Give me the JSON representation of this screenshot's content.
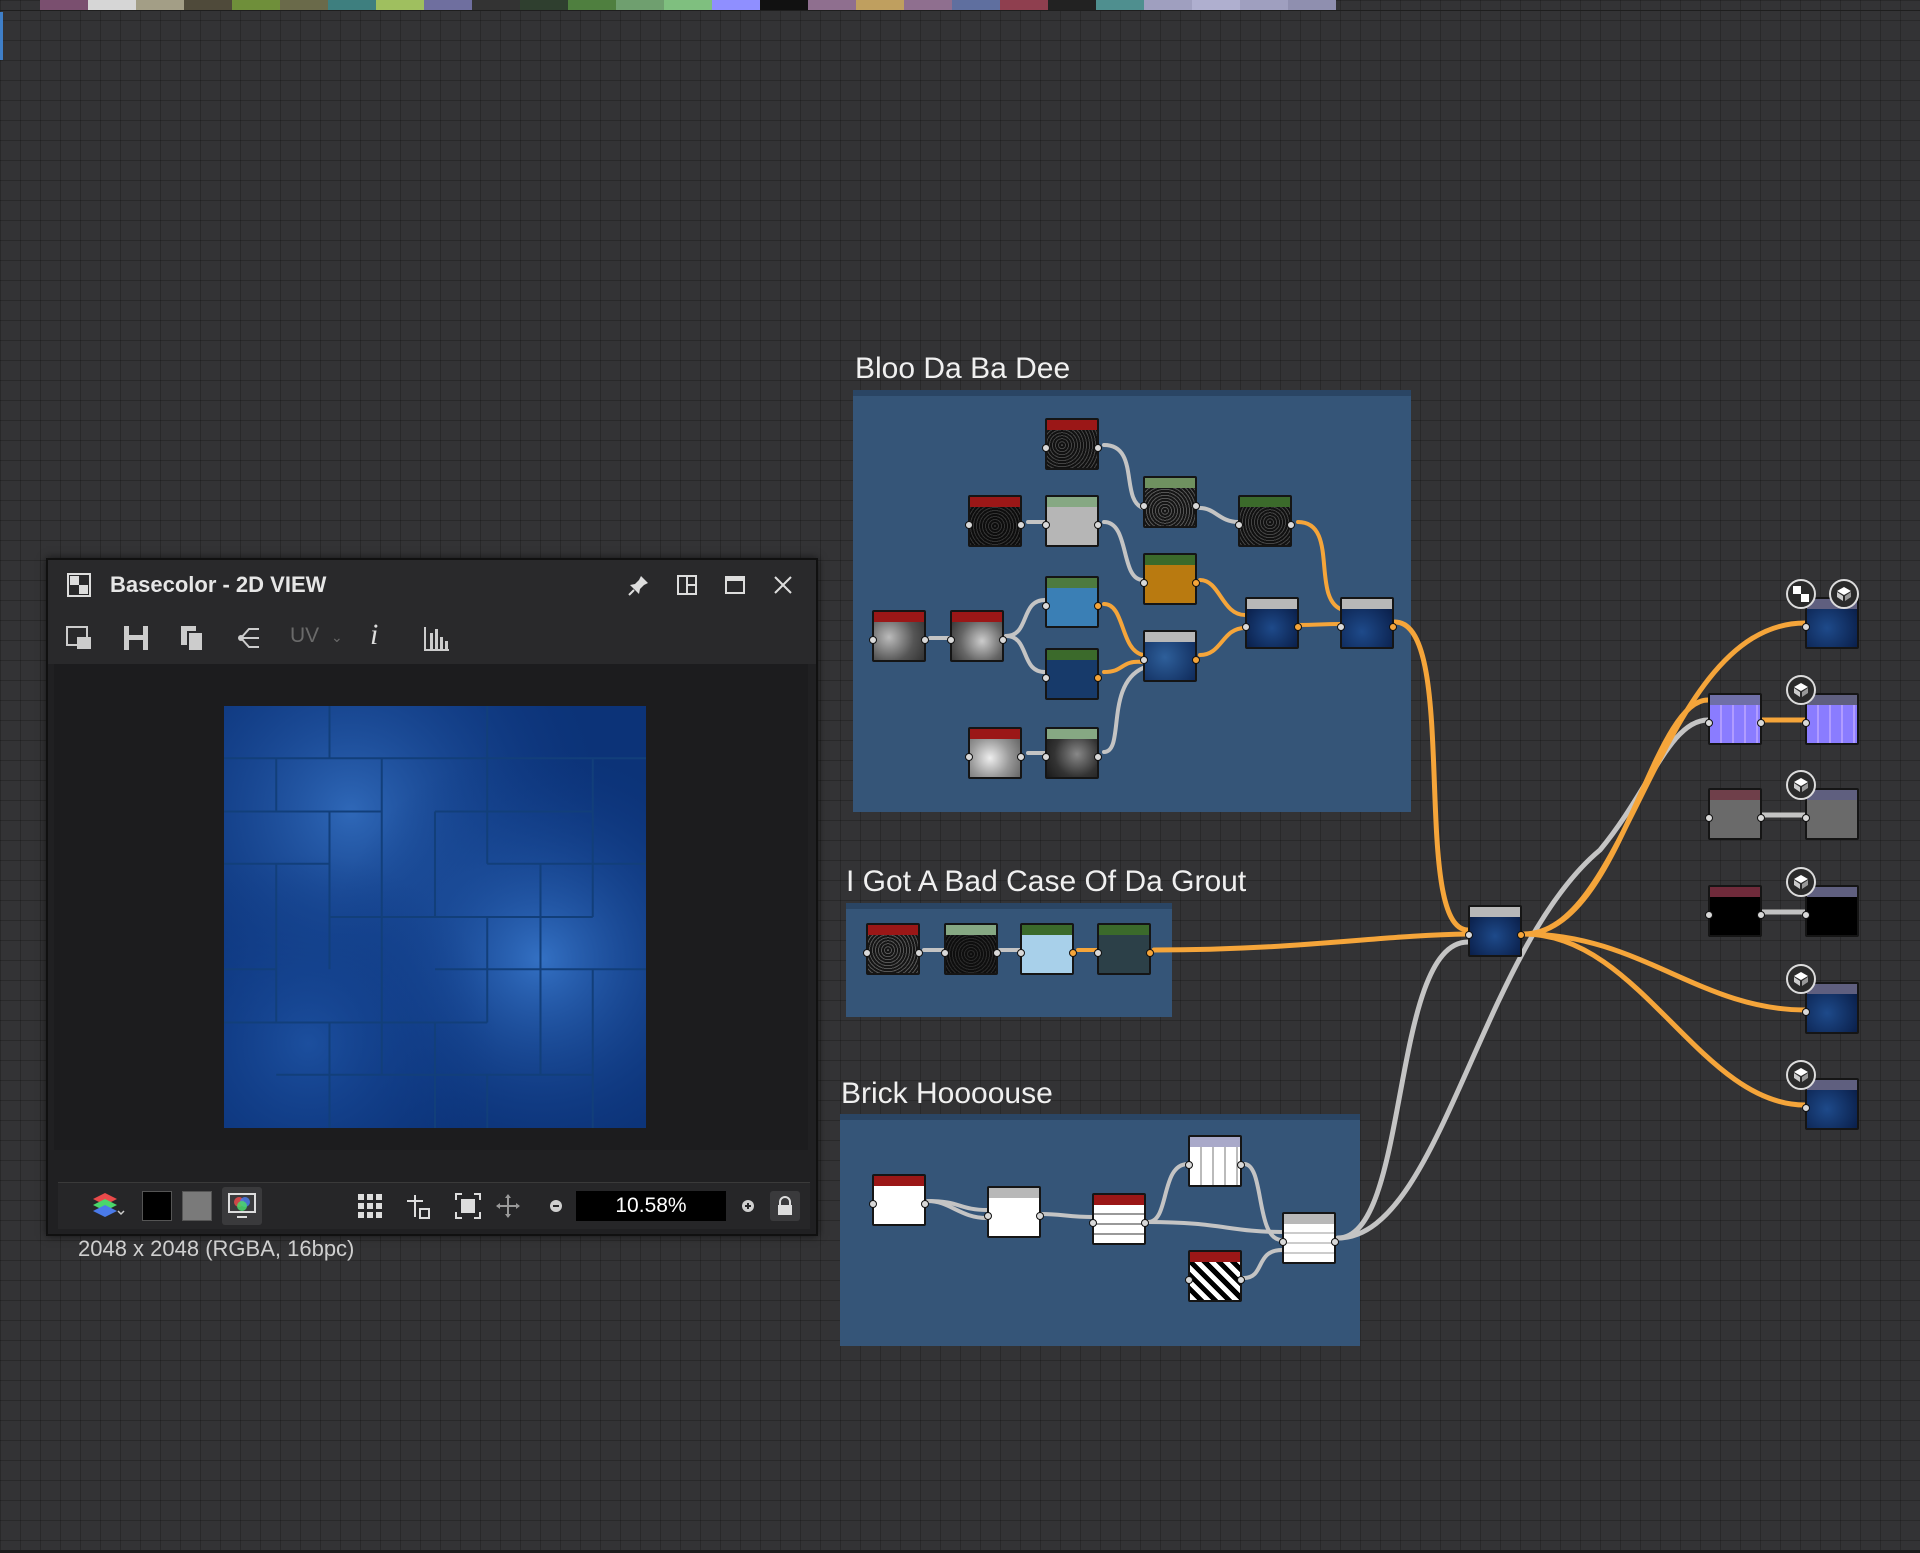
{
  "palette": [
    "#7a4f6f",
    "#d6d6d6",
    "#a39e86",
    "#4f4a3a",
    "#6f8f3a",
    "#6a6a4a",
    "#3e7f7f",
    "#9fbf5f",
    "#6f6f9f",
    "#333333",
    "#2f3f2f",
    "#4f7f3f",
    "#6f9f6f",
    "#7fbf7f",
    "#8f8fff",
    "#111111",
    "#8f6f8f",
    "#bf9f5f",
    "#8f6f8f",
    "#5f6f9f",
    "#8f3f4f",
    "#222222",
    "#4f8f8f",
    "#9f9fbf",
    "#afafcf",
    "#9f9fbf",
    "#8f8faf"
  ],
  "frames": [
    {
      "id": "bloo",
      "title": "Bloo Da Ba Dee"
    },
    {
      "id": "grout",
      "title": "I Got A Bad Case Of Da Grout"
    },
    {
      "id": "brick",
      "title": "Brick Hoooouse"
    }
  ],
  "colors": {
    "canvas": "#333335",
    "frame_fill": "#355578",
    "edge_orange": "#f5a53a",
    "edge_gray": "#c4c4c4",
    "header_red": "#9b1717",
    "header_green": "#4d7a3f",
    "header_grey": "#b8b8b8",
    "header_purple": "#6f6fa8"
  },
  "view2d": {
    "title": "Basecolor - 2D VIEW",
    "uv_label": "UV",
    "info_label": "i",
    "resolution": "2048 x 2048 (RGBA, 16bpc)",
    "zoom": "10.58%",
    "icons": {
      "title": "checker-icon",
      "pin": "pin-icon",
      "layout": "layout-icon",
      "maximize": "maximize-icon",
      "close": "close-icon"
    }
  }
}
